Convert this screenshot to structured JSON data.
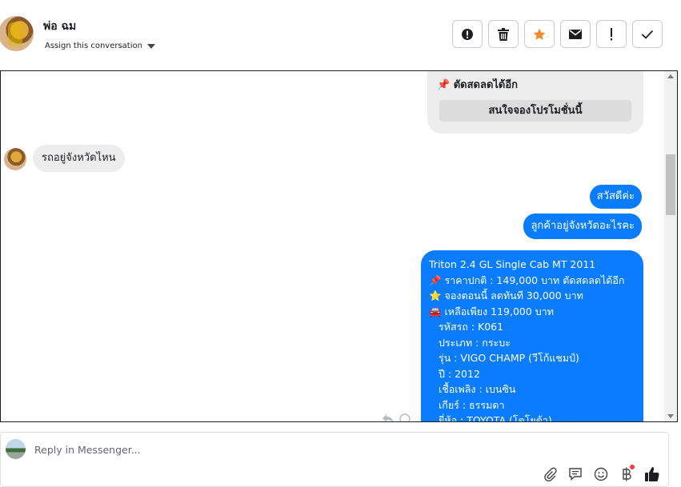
{
  "header": {
    "contact_name": "พ่อ ฉม",
    "assign_label": "Assign this conversation",
    "actions": [
      {
        "name": "alert-icon"
      },
      {
        "name": "trash-icon"
      },
      {
        "name": "star-icon",
        "color": "#f28c28"
      },
      {
        "name": "envelope-icon"
      },
      {
        "name": "exclamation-icon"
      },
      {
        "name": "checkmark-icon"
      }
    ]
  },
  "thread": {
    "card": {
      "text": "📌 ตัดสดลดได้อีก",
      "button_label": "สนใจจองโปรโมชั่นนี้"
    },
    "incoming": [
      {
        "text": "รถอยู่จังหวัดไหน"
      }
    ],
    "outgoing": [
      {
        "text": "สวัสดีค่ะ"
      },
      {
        "text": "ลูกค้าอยู่จังหวัดอะไรคะ"
      }
    ],
    "listing": {
      "lines": [
        "Triton 2.4 GL Single Cab MT 2011",
        "📌 ราคาปกติ : 149,000 บาท ตัดสดลดได้อีก",
        "⭐ จองตอนนี้ ลดทันที 30,000 บาท",
        "🚘 เหลือเพียง 119,000 บาท"
      ],
      "details": [
        "รหัสรถ : K061",
        "ประเภท : กระบะ",
        "รุ่น : VIGO CHAMP (วีโก้แชมป์)",
        "ปี : 2012",
        "เชื้อเพลิง : เบนซิน",
        "เกียร์ : ธรรมดา",
        "ยี่ห้อ : TOYOTA (โตโยต้า)"
      ]
    },
    "accent_color": "#0a7cff"
  },
  "composer": {
    "placeholder": "Reply in Messenger...",
    "tools": [
      {
        "name": "paperclip-icon"
      },
      {
        "name": "saved-reply-icon"
      },
      {
        "name": "emoji-icon"
      },
      {
        "name": "baht-payment-icon"
      },
      {
        "name": "thumbs-up-icon"
      }
    ]
  }
}
